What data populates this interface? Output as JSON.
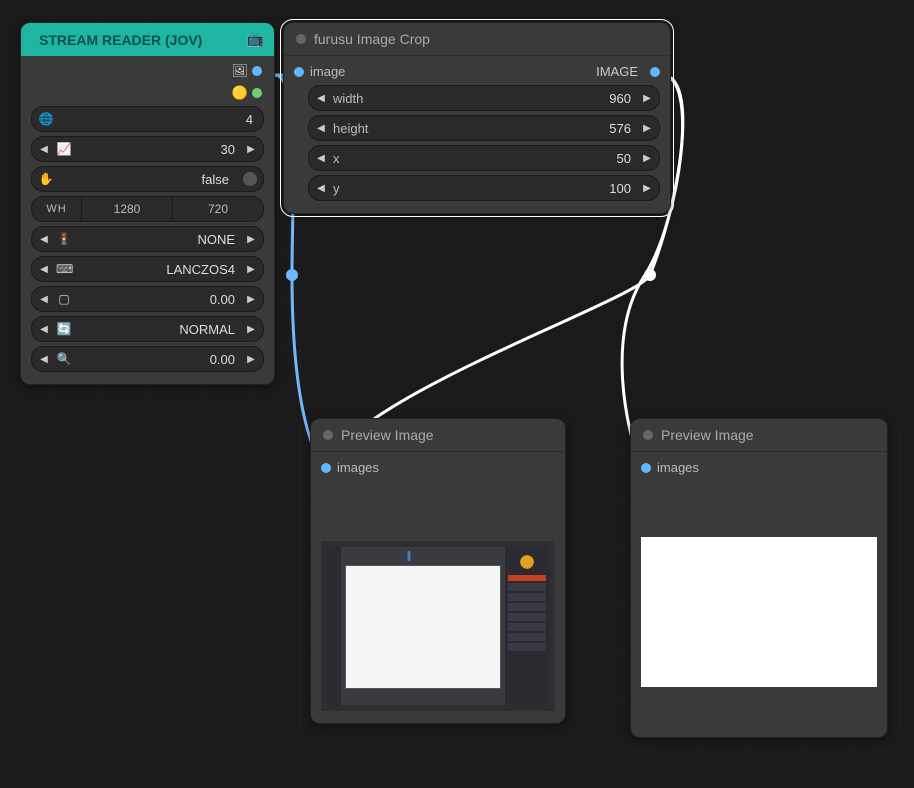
{
  "nodes": {
    "stream": {
      "title": "STREAM READER (JOV)",
      "icon": "📺",
      "outputs": {
        "image_icon": "🖼",
        "mask_icon": "🟡"
      },
      "widgets": {
        "url": {
          "icon": "🌐",
          "value": "4"
        },
        "fps": {
          "icon": "📈",
          "value": "30"
        },
        "paused": {
          "icon": "✋",
          "value": "false"
        },
        "wh": {
          "label": "WH",
          "w": "1280",
          "h": "720"
        },
        "mode": {
          "icon": "🚦",
          "value": "NONE"
        },
        "sample": {
          "icon": "⌨",
          "value": "LANCZOS4"
        },
        "matte": {
          "icon": "▢",
          "value": "0.00"
        },
        "orient": {
          "icon": "🔄",
          "value": "NORMAL"
        },
        "zoom": {
          "icon": "🔍",
          "value": "0.00"
        }
      }
    },
    "crop": {
      "title": "furusu Image Crop",
      "input": {
        "label": "image",
        "type": "IMAGE"
      },
      "widgets": {
        "width": {
          "label": "width",
          "value": "960"
        },
        "height": {
          "label": "height",
          "value": "576"
        },
        "x": {
          "label": "x",
          "value": "50"
        },
        "y": {
          "label": "y",
          "value": "100"
        }
      }
    },
    "preview1": {
      "title": "Preview Image",
      "input": "images"
    },
    "preview2": {
      "title": "Preview Image",
      "input": "images"
    }
  },
  "colors": {
    "image_slot": "#5fb8ff",
    "mask_slot": "#6fcf6f",
    "link_image": "#6fb8ff",
    "link_white": "#ffffff"
  }
}
